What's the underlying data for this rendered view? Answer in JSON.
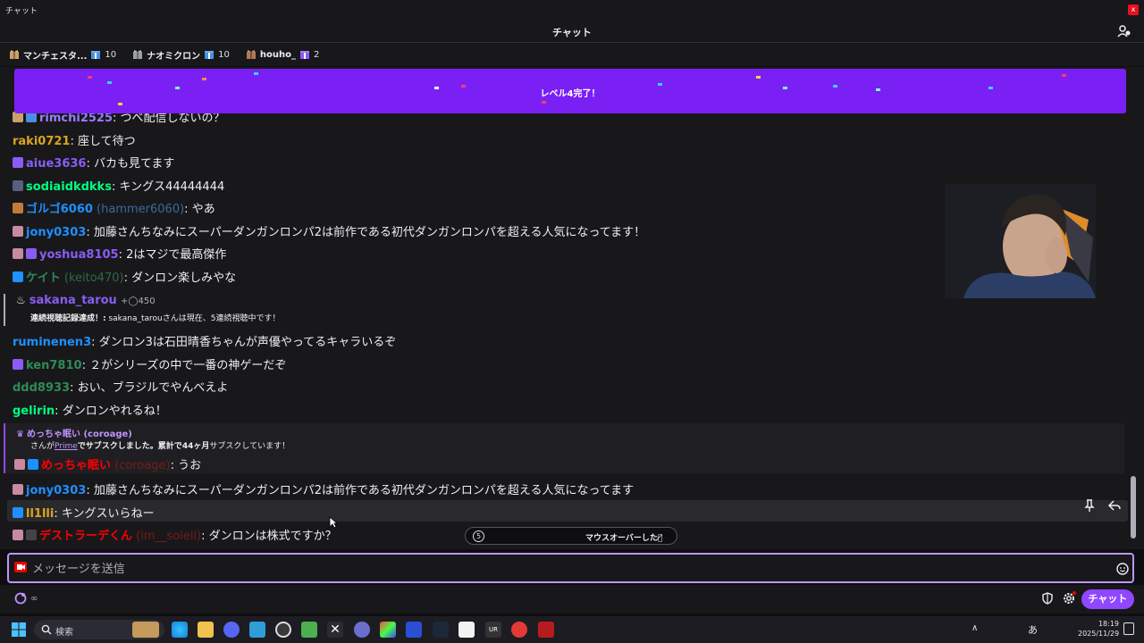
{
  "window": {
    "title": "チャット",
    "close_label": "x"
  },
  "header": {
    "title": "チャット"
  },
  "leaderboard": [
    {
      "name": "マンチェスタ...",
      "count": "10",
      "color": "#efeff1"
    },
    {
      "name": "ナオミクロン",
      "count": "10",
      "color": "#efeff1"
    },
    {
      "name": "houho_",
      "count": "2",
      "color": "#efeff1"
    }
  ],
  "banner": {
    "text": "レベル4完了！",
    "color": "#7a20f5"
  },
  "messages": [
    {
      "user": "rimchi2525",
      "sep": ": ",
      "text": "つべ配信しないの？",
      "color": "#9b7cff"
    },
    {
      "user": "raki0721",
      "sep": ": ",
      "text": "座して待つ",
      "color": "#daa520"
    },
    {
      "user": "aiue3636",
      "sep": ": ",
      "text": "バカも見てます",
      "color": "#8a5cf5"
    },
    {
      "user": "sodiaidkdkks",
      "sep": ": ",
      "text": "キングス44444444",
      "color": "#00ff7f"
    },
    {
      "user": "ゴルゴ6060",
      "extra": " (hammer6060)",
      "sep": ": ",
      "text": "やあ",
      "color": "#1e90ff"
    },
    {
      "user": "jony0303",
      "sep": ": ",
      "text": "加藤さんちなみにスーパーダンガンロンパ2は前作である初代ダンガンロンパを超える人気になってます！",
      "color": "#1e90ff"
    },
    {
      "user": "yoshua8105",
      "sep": ": ",
      "text": "2はマジで最高傑作",
      "color": "#8a5cf5"
    },
    {
      "user": "ケイト",
      "extra": " (keito470)",
      "sep": ": ",
      "text": "ダンロン楽しみやな",
      "color": "#2e8b57"
    },
    {
      "user": "ruminenen3",
      "sep": ": ",
      "text": "ダンロン3は石田晴香ちゃんが声優やってるキャラいるぞ",
      "color": "#1e90ff"
    },
    {
      "user": "ken7810",
      "sep": ":  ",
      "text": "２がシリーズの中で一番の神ゲーだぞ",
      "color": "#2e8b57"
    },
    {
      "user": "ddd8933",
      "sep": ": ",
      "text": "おい、ブラジルでやんべえよ",
      "color": "#2e8b57"
    },
    {
      "user": "gelirin",
      "sep": ": ",
      "text": "ダンロンやれるね！",
      "color": "#00ff7f"
    },
    {
      "user": "jony0303",
      "sep": ": ",
      "text": "加藤さんちなみにスーパーダンガンロンパ2は前作である初代ダンガンロンパを超える人気になってます",
      "color": "#1e90ff"
    },
    {
      "user": "ll1lli",
      "sep": ": ",
      "text": "キングスいらねー",
      "color": "#daa520"
    },
    {
      "user": "デストラーデくん",
      "extra": " (im__soleil)",
      "sep": ": ",
      "text": "ダンロンは株式ですか？",
      "color": "#ff0000"
    }
  ],
  "streak": {
    "user": "sakana_tarou",
    "points": "+◯450",
    "label": "連続視聴記録達成！:",
    "text": " sakana_tarouさんは現在、5連続視聴中です！"
  },
  "sub": {
    "header": "めっちゃ眠い (coroage)",
    "line_a": "さんが",
    "prime": "Prime",
    "line_b": "でサブスクしました。累計で",
    "months": "44ヶ月",
    "line_c": "サブスクしています！",
    "user": "めっちゃ眠い",
    "extra": " (coroage)",
    "sep": ": ",
    "text": "うお",
    "color": "#ff0000"
  },
  "mouseover": {
    "number": "5",
    "text": "マウスオーバーしたた̸"
  },
  "input": {
    "placeholder": "メッセージを送信"
  },
  "bottom": {
    "points": "∞",
    "chat_button": "チャット"
  },
  "taskbar": {
    "search": "検索",
    "time": "18:19",
    "date": "2025/11/29",
    "ime": "あ"
  },
  "colors": {
    "accent": "#9147ff",
    "background": "#18181b"
  }
}
